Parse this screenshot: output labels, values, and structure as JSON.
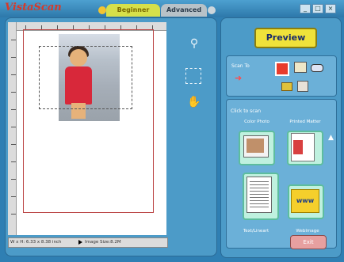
{
  "app": {
    "title_logo": "VistaScan"
  },
  "tabs": {
    "beginner": "Beginner",
    "advanced": "Advanced"
  },
  "window_buttons": {
    "minimize": "_",
    "restore": "□",
    "close": "×"
  },
  "status_bar": {
    "left_text": "W x H: 6.33 x 8.38 inch",
    "right_text": "Image Size:8.2M"
  },
  "right_panel": {
    "preview_label": "Preview",
    "scan_to_label": "Scan To",
    "click_to_scan_label": "Click to scan",
    "categories": {
      "color_photo": "Color Photo",
      "printed_matter": "Printed Matter",
      "text_lineart": "Text/Lineart",
      "web_image": "WebImage"
    },
    "web_thumb_text": "www",
    "exit_label": "Exit"
  },
  "colors": {
    "accent": "#f0e23a",
    "panel": "#4c9bc8",
    "selected_dest": "#e83c2c"
  }
}
